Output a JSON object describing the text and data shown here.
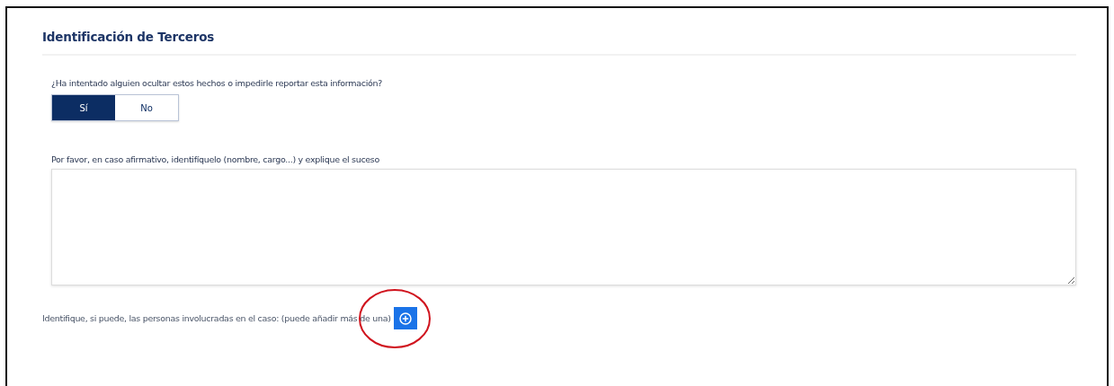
{
  "section": {
    "title": "Identificación de Terceros"
  },
  "question": {
    "label": "¿Ha intentado alguien ocultar estos hechos o impedirle reportar esta información?",
    "options": [
      {
        "label": "Sí",
        "selected": true
      },
      {
        "label": "No",
        "selected": false
      }
    ]
  },
  "details": {
    "label": "Por favor, en caso afirmativo, identifíquelo (nombre, cargo...) y explique el suceso"
  },
  "people": {
    "label": "Identifique, si puede, las personas involucradas en el caso: (puede añadir más de una)"
  },
  "annotation": {
    "kind": "circle",
    "color": "#d0141e"
  }
}
